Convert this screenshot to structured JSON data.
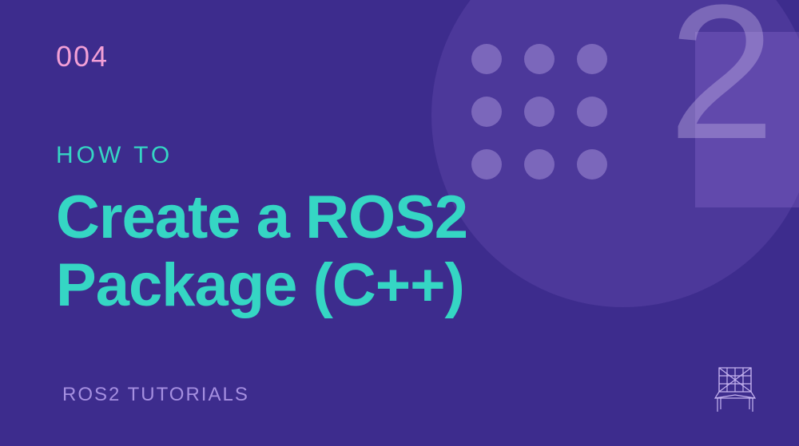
{
  "episode_number": "004",
  "howto_label": "HOW TO",
  "main_title": "Create a ROS2\nPackage (C++)",
  "series_label": "ROS2 TUTORIALS",
  "big_number": "2",
  "colors": {
    "background": "#3d2c8d",
    "accent_pink": "#f29fd6",
    "accent_teal": "#35d6c4",
    "muted_purple": "#a58fe0"
  }
}
